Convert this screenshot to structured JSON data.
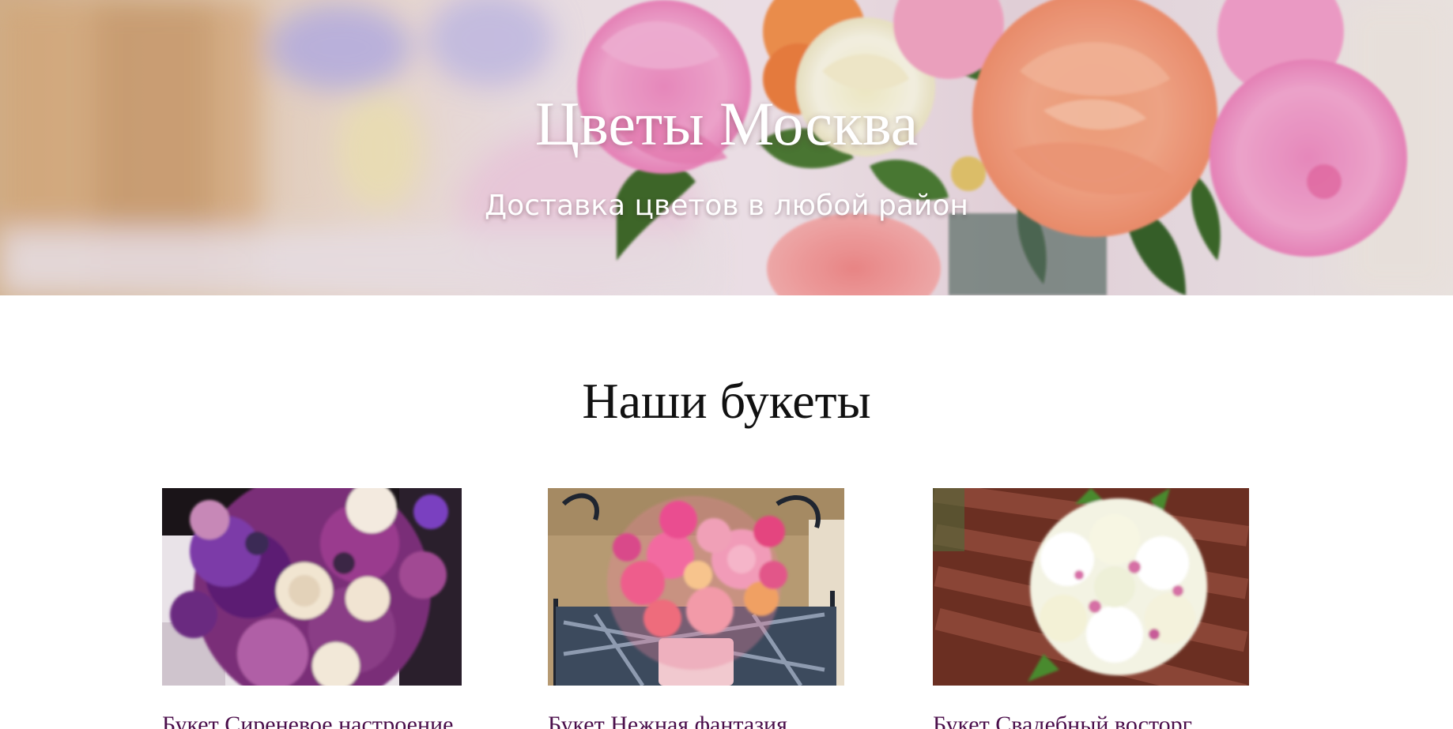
{
  "hero": {
    "title": "Цветы Москва",
    "subtitle": "Доставка цветов в любой район"
  },
  "section": {
    "title": "Наши букеты"
  },
  "bouquets": [
    {
      "name": "Букет Сиреневое настроение",
      "photo": "purple-bouquet-photo"
    },
    {
      "name": "Букет Нежная фантазия",
      "photo": "pink-bouquet-photo"
    },
    {
      "name": "Букет Свадебный восторг",
      "photo": "white-bouquet-photo"
    }
  ],
  "colors": {
    "hero_text": "#ffffff",
    "section_title": "#111111",
    "card_name": "#4b0f4b",
    "background": "#ffffff"
  }
}
